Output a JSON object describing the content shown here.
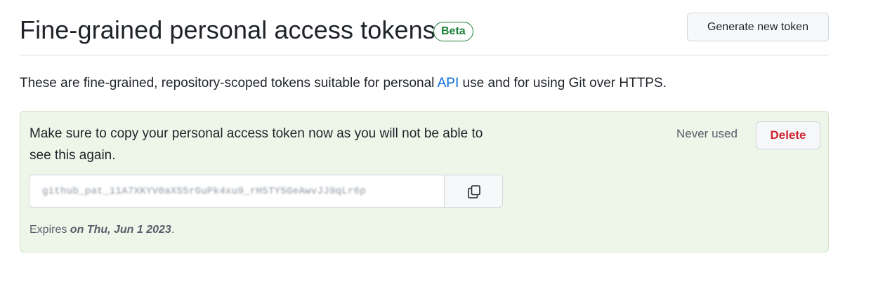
{
  "header": {
    "title": "Fine-grained personal access tokens",
    "badge": "Beta",
    "generate_button": "Generate new token"
  },
  "description": {
    "before_link": "These are fine-grained, repository-scoped tokens suitable for personal ",
    "link_text": "API",
    "after_link": " use and for using Git over HTTPS."
  },
  "token_notice": {
    "message": "Make sure to copy your personal access token now as you will not be able to see this again.",
    "usage_status": "Never used",
    "delete_button": "Delete",
    "token_value": "github_pat_11A7XKYV0aXS5rGuPk4xu9_rH5TY5GeAwvJJ9qLr6p",
    "copy_icon": "copy-icon",
    "expires_label": "Expires ",
    "expires_date": "on Thu, Jun 1 2023",
    "expires_suffix": "."
  },
  "colors": {
    "accent_link": "#0969da",
    "beta_green": "#1a7f37",
    "danger": "#cf222e",
    "success_bg": "#eef6ea"
  }
}
